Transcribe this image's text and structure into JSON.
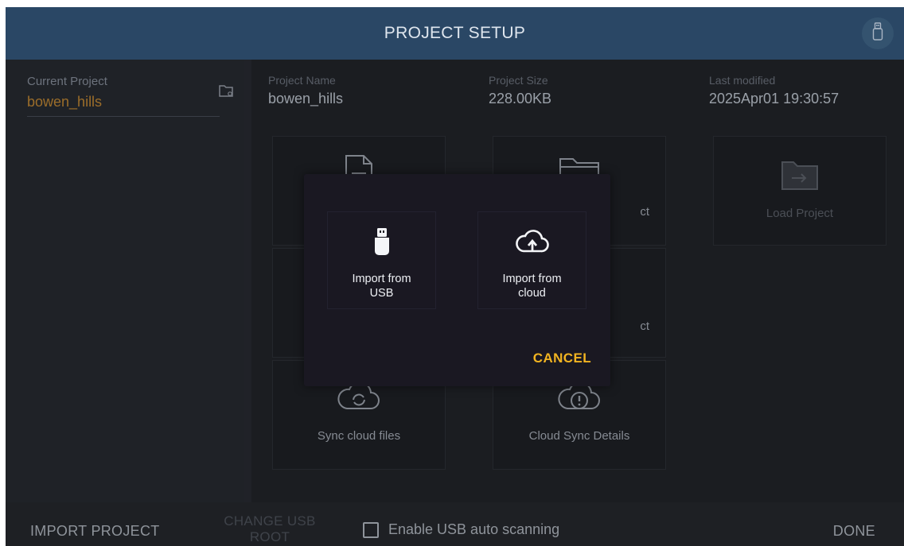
{
  "header": {
    "title": "PROJECT SETUP",
    "usb_icon": "usb-icon"
  },
  "sidebar": {
    "current_project_label": "Current Project",
    "current_project_value": "bowen_hills",
    "folder_icon": "folder-open-icon"
  },
  "project_info": {
    "name_label": "Project Name",
    "name_value": "bowen_hills",
    "size_label": "Project Size",
    "size_value": "228.00KB",
    "modified_label": "Last modified",
    "modified_value": "2025Apr01 19:30:57"
  },
  "tiles": {
    "open_project_partial": "ct",
    "load_project": "Load Project",
    "second_row_partial": "ct",
    "sync_cloud_files": "Sync cloud files",
    "cloud_sync_details": "Cloud Sync Details"
  },
  "footer": {
    "import_project": "IMPORT PROJECT",
    "change_usb_root": "CHANGE USB ROOT",
    "usb_auto_scanning": "Enable USB auto scanning",
    "usb_auto_scanning_checked": false,
    "done": "DONE"
  },
  "dialog": {
    "import_usb_line1": "Import from",
    "import_usb_line2": "USB",
    "import_cloud_line1": "Import from",
    "import_cloud_line2": "cloud",
    "cancel": "CANCEL"
  },
  "colors": {
    "header_bg": "#2a4765",
    "accent_orange": "#f2b421",
    "current_project_text": "#9b6d2a",
    "dialog_bg": "#1a1822"
  }
}
